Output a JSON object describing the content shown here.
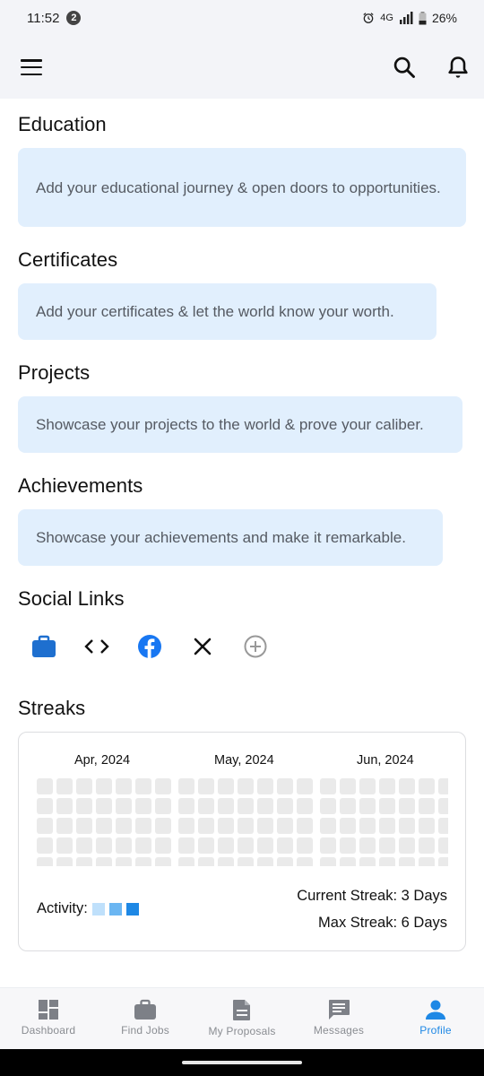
{
  "status_bar": {
    "time": "11:52",
    "notification_count": "2",
    "network": "4G",
    "battery": "26%"
  },
  "sections": {
    "education": {
      "title": "Education",
      "text": "Add your educational journey & open doors to opportunities."
    },
    "certificates": {
      "title": "Certificates",
      "text": "Add your certificates & let the world know your worth."
    },
    "projects": {
      "title": "Projects",
      "text": "Showcase your projects to the world & prove your caliber."
    },
    "achievements": {
      "title": "Achievements",
      "text": "Showcase your achievements and make it remarkable."
    },
    "social_links": {
      "title": "Social Links",
      "icons": [
        "briefcase-icon",
        "code-icon",
        "facebook-icon",
        "x-icon",
        "add-circle-icon"
      ]
    }
  },
  "streaks": {
    "title": "Streaks",
    "months": [
      "Apr, 2024",
      "May, 2024",
      "Jun, 2024"
    ],
    "activity_label": "Activity:",
    "activity_colors": [
      "#bfe0fb",
      "#6bb6f2",
      "#1e88e5"
    ],
    "current_streak": "Current Streak: 3 Days",
    "max_streak": "Max Streak: 6 Days"
  },
  "bottom_nav": {
    "items": [
      {
        "label": "Dashboard",
        "icon": "dashboard-icon"
      },
      {
        "label": "Find Jobs",
        "icon": "briefcase-icon"
      },
      {
        "label": "My Proposals",
        "icon": "document-icon"
      },
      {
        "label": "Messages",
        "icon": "message-icon"
      },
      {
        "label": "Profile",
        "icon": "person-icon",
        "active": true
      }
    ]
  },
  "colors": {
    "accent": "#1e88e5",
    "info_box_bg": "#e1effd",
    "cell_empty": "#eaeaea"
  }
}
